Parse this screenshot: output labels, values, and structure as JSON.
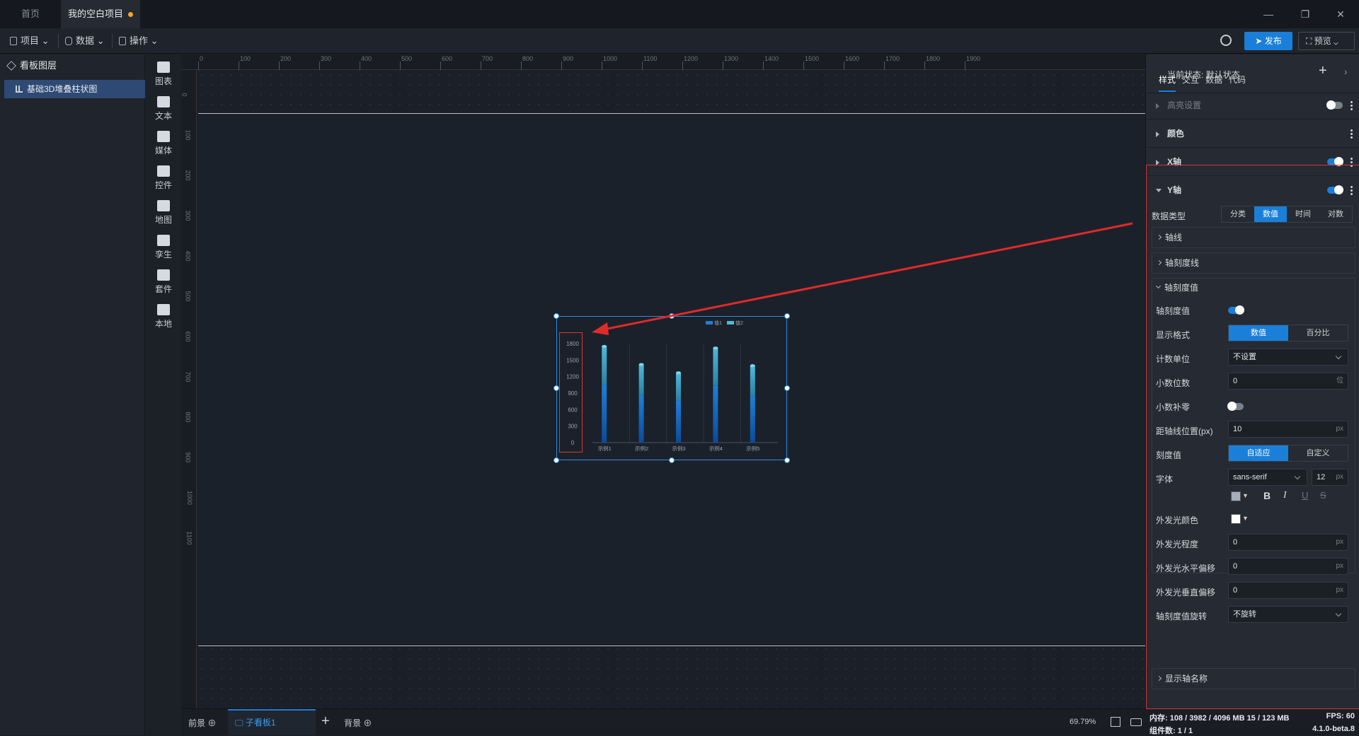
{
  "titlebar": {
    "tab_home": "首页",
    "tab_project": "我的空白项目"
  },
  "toolbar": {
    "menu_project": "项目",
    "menu_data": "数据",
    "menu_ops": "操作",
    "publish": "发布",
    "preview": "预览"
  },
  "layers": {
    "title": "看板图层",
    "item": "基础3D堆叠柱状图"
  },
  "tools": [
    "图表",
    "文本",
    "媒体",
    "控件",
    "地图",
    "孪生",
    "套件",
    "本地"
  ],
  "hruler_ticks": [
    "0",
    "100",
    "200",
    "300",
    "400",
    "500",
    "600",
    "700",
    "800",
    "900",
    "1000",
    "1100",
    "1200",
    "1300",
    "1400",
    "1500",
    "1600",
    "1700",
    "1800",
    "1900"
  ],
  "vruler_ticks": [
    "0",
    "100",
    "200",
    "300",
    "400",
    "500",
    "600",
    "700",
    "800",
    "900",
    "1000",
    "1100"
  ],
  "chart_data": {
    "type": "bar",
    "categories": [
      "示例1",
      "示例2",
      "示例3",
      "示例4",
      "示例5"
    ],
    "series": [
      {
        "name": "值1"
      },
      {
        "name": "值2"
      }
    ],
    "values": [
      1750,
      1420,
      1270,
      1720,
      1400
    ],
    "yticks": [
      "1800",
      "1500",
      "1200",
      "900",
      "600",
      "300",
      "0"
    ],
    "ylim": [
      0,
      1800
    ]
  },
  "bottom": {
    "front": "前景",
    "board": "子看板1",
    "background": "背景",
    "zoom": "69.79%"
  },
  "panel": {
    "state_label": "当前状态:",
    "state_value": "默认状态",
    "tabs": [
      "样式",
      "交互",
      "数据",
      "代码"
    ],
    "sec_highlight": "高亮设置",
    "sec_color": "颜色",
    "sec_xaxis": "X轴",
    "sec_yaxis": "Y轴",
    "data_type_label": "数据类型",
    "data_types": [
      "分类",
      "数值",
      "时间",
      "对数"
    ],
    "sub_axisline": "轴线",
    "sub_ticks": "轴刻度线",
    "sub_tickvals": "轴刻度值",
    "tickval_label": "轴刻度值",
    "format_label": "显示格式",
    "format_opts": [
      "数值",
      "百分比"
    ],
    "unit_label": "计数单位",
    "unit_value": "不设置",
    "decimals_label": "小数位数",
    "decimals_value": "0",
    "decimals_unit": "位",
    "pad_label": "小数补零",
    "dist_label": "距轴线位置(px)",
    "dist_value": "10",
    "px": "px",
    "scale_label": "刻度值",
    "scale_opts": [
      "自适应",
      "自定义"
    ],
    "font_label": "字体",
    "font_value": "sans-serif",
    "font_size": "12",
    "bold": "B",
    "italic": "I",
    "underline": "U",
    "strike": "S",
    "glow_color_label": "外发光颜色",
    "glow_level_label": "外发光程度",
    "glow_level": "0",
    "glow_h_label": "外发光水平偏移",
    "glow_h": "0",
    "glow_v_label": "外发光垂直偏移",
    "glow_v": "0",
    "rotate_label": "轴刻度值旋转",
    "rotate_value": "不旋转",
    "show_axis_name": "显示轴名称"
  },
  "statusbar": {
    "memory": "内存: 108 / 3982 / 4096 MB  15 / 123 MB",
    "fps": "FPS: 60",
    "components": "组件数: 1 / 1",
    "version": "4.1.0-beta.8"
  }
}
